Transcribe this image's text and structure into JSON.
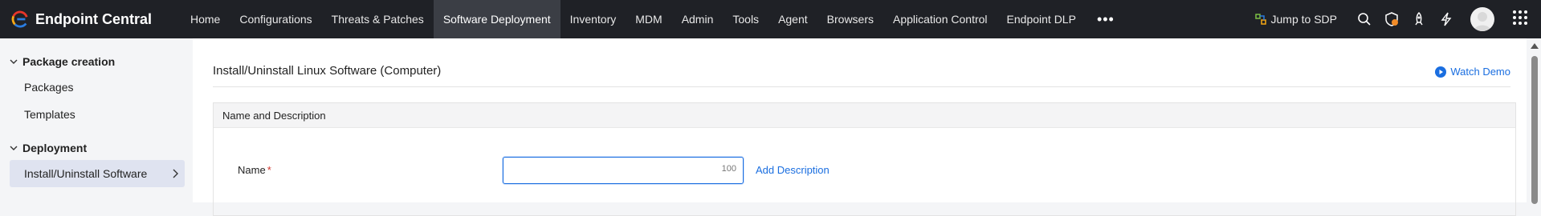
{
  "brand": {
    "name": "Endpoint Central"
  },
  "nav": {
    "items": [
      {
        "label": "Home"
      },
      {
        "label": "Configurations"
      },
      {
        "label": "Threats & Patches"
      },
      {
        "label": "Software Deployment"
      },
      {
        "label": "Inventory"
      },
      {
        "label": "MDM"
      },
      {
        "label": "Admin"
      },
      {
        "label": "Tools"
      },
      {
        "label": "Agent"
      },
      {
        "label": "Browsers"
      },
      {
        "label": "Application Control"
      },
      {
        "label": "Endpoint DLP"
      }
    ],
    "more_label": "•••",
    "active_index": 3
  },
  "toolbar": {
    "jump_label": "Jump to SDP"
  },
  "sidebar": {
    "sections": [
      {
        "title": "Package creation",
        "items": [
          {
            "label": "Packages"
          },
          {
            "label": "Templates"
          }
        ]
      },
      {
        "title": "Deployment",
        "items": [
          {
            "label": "Install/Uninstall Software",
            "active": true
          }
        ]
      }
    ]
  },
  "main": {
    "title": "Install/Uninstall Linux Software (Computer)",
    "watch_demo": "Watch Demo",
    "panel": {
      "heading": "Name and Description",
      "name_label": "Name",
      "required_mark": "*",
      "name_value": "",
      "char_count": "100",
      "add_description": "Add Description"
    }
  },
  "colors": {
    "topbar": "#1f2126",
    "accent": "#1a6ee0",
    "active_nav": "#3b3e45"
  }
}
